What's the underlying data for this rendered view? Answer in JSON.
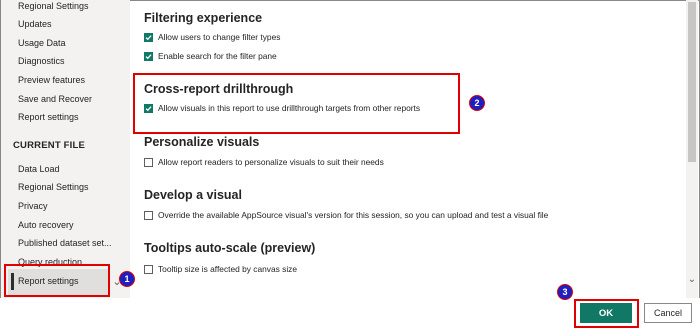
{
  "sidebar": {
    "items_top": [
      {
        "label": "Regional Settings"
      },
      {
        "label": "Updates"
      },
      {
        "label": "Usage Data"
      },
      {
        "label": "Diagnostics"
      },
      {
        "label": "Preview features"
      },
      {
        "label": "Save and Recover"
      },
      {
        "label": "Report settings"
      }
    ],
    "current_file_heading": "CURRENT FILE",
    "items_current": [
      {
        "label": "Data Load"
      },
      {
        "label": "Regional Settings"
      },
      {
        "label": "Privacy"
      },
      {
        "label": "Auto recovery"
      },
      {
        "label": "Published dataset set..."
      },
      {
        "label": "Query reduction"
      },
      {
        "label": "Report settings"
      }
    ]
  },
  "sections": [
    {
      "title": "Filtering experience",
      "options": [
        {
          "label": "Allow users to change filter types",
          "checked": true
        },
        {
          "label": "Enable search for the filter pane",
          "checked": true
        }
      ]
    },
    {
      "title": "Cross-report drillthrough",
      "options": [
        {
          "label": "Allow visuals in this report to use drillthrough targets from other reports",
          "checked": true
        }
      ]
    },
    {
      "title": "Personalize visuals",
      "options": [
        {
          "label": "Allow report readers to personalize visuals to suit their needs",
          "checked": false
        }
      ]
    },
    {
      "title": "Develop a visual",
      "options": [
        {
          "label": "Override the available AppSource visual's version for this session, so you can upload and test a visual file",
          "checked": false
        }
      ]
    },
    {
      "title": "Tooltips auto-scale (preview)",
      "options": [
        {
          "label": "Tooltip size is affected by canvas size",
          "checked": false
        }
      ]
    }
  ],
  "footer": {
    "ok_label": "OK",
    "cancel_label": "Cancel"
  },
  "annotations": {
    "badge_1": "1",
    "badge_2": "2",
    "badge_3": "3",
    "highlight_color": "#e00000",
    "badge_color": "#1f1fbf"
  },
  "colors": {
    "accent": "#117865",
    "sidebar_bg": "#f3f2f1"
  },
  "icons": {
    "checkbox_checked": "checkmark-icon",
    "sidebar_scroll": "chevron-down-icon",
    "main_scroll": "chevron-down-icon"
  }
}
